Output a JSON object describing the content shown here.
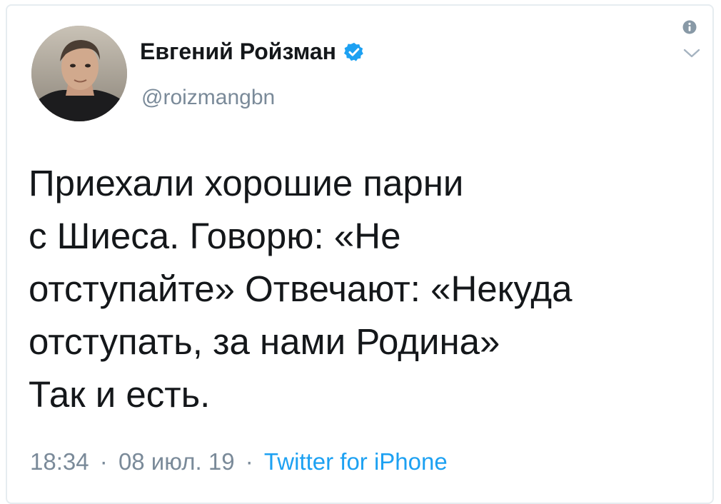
{
  "author": {
    "name": "Евгений Ройзман",
    "handle": "@roizmangbn",
    "verified": true
  },
  "tweet": {
    "text": "Приехали хорошие парни\nс Шиеса.  Говорю: «Не\nотступайте» Отвечают: «Некуда\nотступать, за нами Родина»\nТак и есть."
  },
  "meta": {
    "time": "18:34",
    "date": "08 июл. 19",
    "separator": "·",
    "source": "Twitter for iPhone"
  },
  "colors": {
    "text": "#14171a",
    "secondary": "#7a8a99",
    "accent": "#1da1f2",
    "border": "#e6ecf0"
  },
  "icons": {
    "verified": "verified-badge-icon",
    "info": "info-icon",
    "menu": "chevron-down-icon"
  }
}
